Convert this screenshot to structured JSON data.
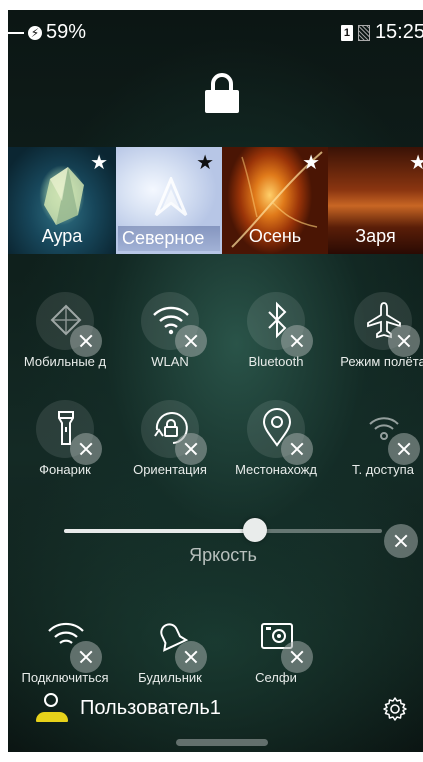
{
  "status_bar": {
    "battery": "59%",
    "sim": "1",
    "time": "15:25"
  },
  "wallpapers": [
    {
      "label": "Аура"
    },
    {
      "label": "Северное"
    },
    {
      "label": "Осень"
    },
    {
      "label": "Заря"
    }
  ],
  "tiles_row1": [
    {
      "label": "Мобильные д"
    },
    {
      "label": "WLAN"
    },
    {
      "label": "Bluetooth"
    },
    {
      "label": "Режим полёта"
    }
  ],
  "tiles_row2": [
    {
      "label": "Фонарик"
    },
    {
      "label": "Ориентация"
    },
    {
      "label": "Местонахожд"
    },
    {
      "label": "Т. доступа"
    }
  ],
  "brightness": {
    "label": "Яркость",
    "level": 0.6
  },
  "tiles_row3": [
    {
      "label": "Подключиться"
    },
    {
      "label": "Будильник"
    },
    {
      "label": "Селфи"
    }
  ],
  "user": {
    "name": "Пользователь1"
  },
  "colors": {
    "avatar_accent": "#e7d21a",
    "background": "#142a25"
  }
}
